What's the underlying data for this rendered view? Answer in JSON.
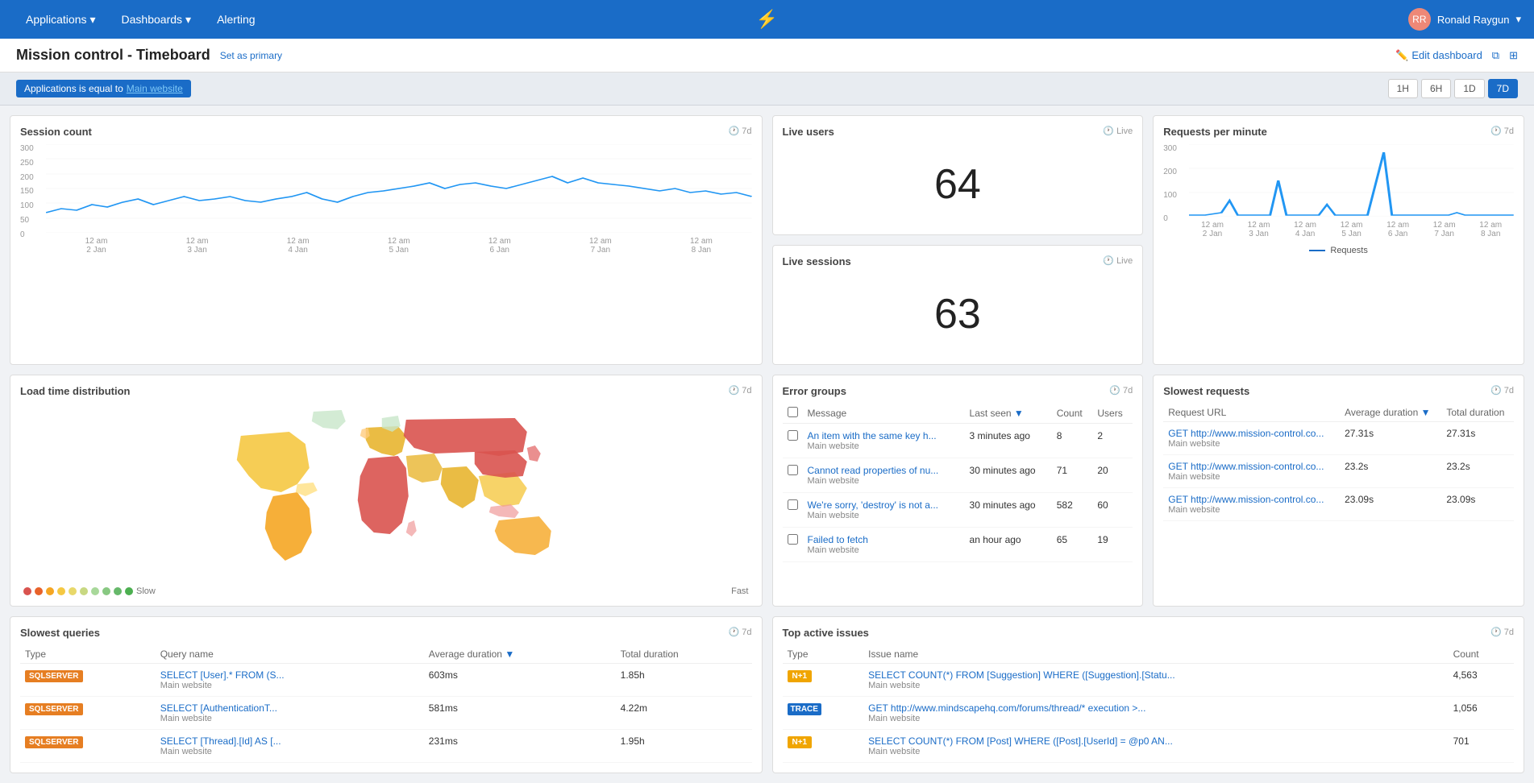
{
  "nav": {
    "applications_label": "Applications",
    "dashboards_label": "Dashboards",
    "alerting_label": "Alerting",
    "user_name": "Ronald Raygun"
  },
  "page": {
    "title": "Mission control - Timeboard",
    "set_primary": "Set as primary",
    "edit_dashboard": "Edit dashboard"
  },
  "filter": {
    "label": "Applications  is equal to",
    "value": "Main website"
  },
  "time_buttons": [
    "1H",
    "6H",
    "1D",
    "7D"
  ],
  "active_time": "7D",
  "session_count": {
    "title": "Session count",
    "badge": "7d",
    "y_labels": [
      "300",
      "250",
      "200",
      "150",
      "100",
      "50",
      "0"
    ],
    "x_labels": [
      "12 am\n2 Jan",
      "12 am\n3 Jan",
      "12 am\n4 Jan",
      "12 am\n5 Jan",
      "12 am\n6 Jan",
      "12 am\n7 Jan",
      "12 am\n8 Jan"
    ]
  },
  "live_users": {
    "title": "Live users",
    "badge": "Live",
    "value": "64"
  },
  "live_sessions": {
    "title": "Live sessions",
    "badge": "Live",
    "value": "63"
  },
  "error_groups": {
    "title": "Error groups",
    "badge": "7d",
    "columns": [
      "Message",
      "Last seen",
      "Count",
      "Users"
    ],
    "rows": [
      {
        "message": "An item with the same key h...",
        "site": "Main website",
        "last_seen": "3 minutes ago",
        "count": "8",
        "users": "2"
      },
      {
        "message": "Cannot read properties of nu...",
        "site": "Main website",
        "last_seen": "30 minutes ago",
        "count": "71",
        "users": "20"
      },
      {
        "message": "We're sorry, 'destroy' is not a...",
        "site": "Main website",
        "last_seen": "30 minutes ago",
        "count": "582",
        "users": "60"
      },
      {
        "message": "Failed to fetch",
        "site": "Main website",
        "last_seen": "an hour ago",
        "count": "65",
        "users": "19"
      }
    ]
  },
  "requests_per_minute": {
    "title": "Requests per minute",
    "badge": "7d",
    "y_labels": [
      "300",
      "200",
      "100",
      "0"
    ],
    "x_labels": [
      "12 am\n2 Jan",
      "12 am\n3 Jan",
      "12 am\n4 Jan",
      "12 am\n5 Jan",
      "12 am\n6 Jan",
      "12 am\n7 Jan",
      "12 am\n8 Jan"
    ],
    "legend": "Requests"
  },
  "load_time": {
    "title": "Load time distribution",
    "badge": "7d",
    "legend_slow": "Slow",
    "legend_fast": "Fast"
  },
  "slowest_queries": {
    "title": "Slowest queries",
    "badge": "7d",
    "columns": [
      "Type",
      "Query name",
      "Average duration",
      "Total duration"
    ],
    "rows": [
      {
        "type": "SQLSERVER",
        "query": "SELECT [User].* FROM (S...",
        "site": "Main website",
        "avg": "603ms",
        "total": "1.85h"
      },
      {
        "type": "SQLSERVER",
        "query": "SELECT [AuthenticationT...",
        "site": "Main website",
        "avg": "581ms",
        "total": "4.22m"
      },
      {
        "type": "SQLSERVER",
        "query": "SELECT [Thread].[Id] AS [...",
        "site": "Main website",
        "avg": "231ms",
        "total": "1.95h"
      }
    ]
  },
  "slowest_requests": {
    "title": "Slowest requests",
    "badge": "7d",
    "columns": [
      "Request URL",
      "Average duration",
      "Total duration"
    ],
    "rows": [
      {
        "url": "GET http://www.mission-control.co...",
        "site": "Main website",
        "avg": "27.31s",
        "total": "27.31s"
      },
      {
        "url": "GET http://www.mission-control.co...",
        "site": "Main website",
        "avg": "23.2s",
        "total": "23.2s"
      },
      {
        "url": "GET http://www.mission-control.co...",
        "site": "Main website",
        "avg": "23.09s",
        "total": "23.09s"
      }
    ]
  },
  "top_active_issues": {
    "title": "Top active issues",
    "badge": "7d",
    "columns": [
      "Type",
      "Issue name",
      "Count"
    ],
    "rows": [
      {
        "type": "N+1",
        "type_class": "n1",
        "issue": "SELECT COUNT(*) FROM [Suggestion] WHERE ([Suggestion].[Statu...",
        "site": "Main website",
        "count": "4,563"
      },
      {
        "type": "TRACE",
        "type_class": "trace",
        "issue": "GET http://www.mindscapehq.com/forums/thread/* execution >...",
        "site": "Main website",
        "count": "1,056"
      },
      {
        "type": "N+1",
        "type_class": "n1",
        "issue": "SELECT COUNT(*) FROM [Post] WHERE ([Post].[UserId] = @p0 AN...",
        "site": "Main website",
        "count": "701"
      }
    ]
  }
}
